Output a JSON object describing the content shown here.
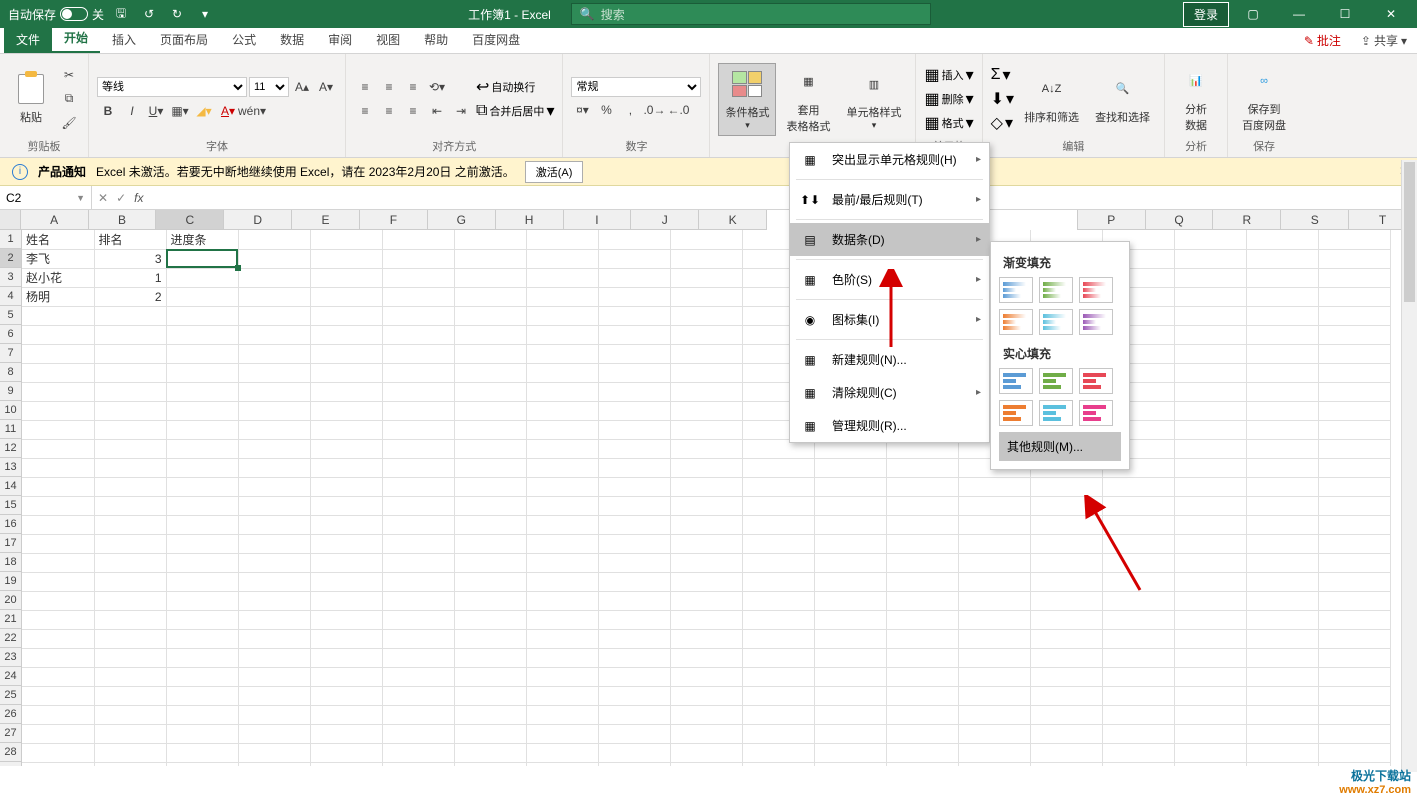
{
  "titlebar": {
    "autosave_label": "自动保存",
    "autosave_state": "关",
    "doc_title": "工作簿1 - Excel",
    "search_placeholder": "搜索",
    "login": "登录"
  },
  "tabs": {
    "file": "文件",
    "items": [
      "开始",
      "插入",
      "页面布局",
      "公式",
      "数据",
      "审阅",
      "视图",
      "帮助",
      "百度网盘"
    ],
    "active_index": 0,
    "comments": "批注",
    "share": "共享"
  },
  "ribbon": {
    "clipboard": {
      "paste": "粘贴",
      "label": "剪贴板"
    },
    "font": {
      "name": "等线",
      "size": "11",
      "label": "字体"
    },
    "align": {
      "wrap": "自动换行",
      "merge": "合并后居中",
      "label": "对齐方式"
    },
    "number": {
      "format": "常规",
      "label": "数字"
    },
    "styles": {
      "cond": "条件格式",
      "tablefmt_l1": "套用",
      "tablefmt_l2": "表格格式",
      "cellstyle": "单元格样式"
    },
    "cells": {
      "insert": "插入",
      "delete": "删除",
      "format": "格式",
      "label": "单元格"
    },
    "editing": {
      "sort": "排序和筛选",
      "find": "查找和选择",
      "label": "编辑"
    },
    "analysis": {
      "btn_l1": "分析",
      "btn_l2": "数据",
      "label": "分析"
    },
    "save": {
      "btn_l1": "保存到",
      "btn_l2": "百度网盘",
      "label": "保存"
    }
  },
  "notif": {
    "title": "产品通知",
    "msg": "Excel 未激活。若要无中断地继续使用 Excel，请在 2023年2月20日 之前激活。",
    "btn": "激活(A)"
  },
  "formula_bar": {
    "cell_ref": "C2",
    "fx": "fx",
    "value": ""
  },
  "sheet": {
    "columns": [
      "A",
      "B",
      "C",
      "D",
      "E",
      "F",
      "G",
      "H",
      "I",
      "J",
      "K",
      "P",
      "Q",
      "R",
      "S",
      "T"
    ],
    "sel_col": "C",
    "sel_row": 2,
    "headers": {
      "A": "姓名",
      "B": "排名",
      "C": "进度条"
    },
    "rows": [
      {
        "A": "李飞",
        "B": "3"
      },
      {
        "A": "赵小花",
        "B": "1"
      },
      {
        "A": "杨明",
        "B": "2"
      }
    ]
  },
  "menu": {
    "highlight": "突出显示单元格规则(H)",
    "toprules": "最前/最后规则(T)",
    "databar": "数据条(D)",
    "colorscale": "色阶(S)",
    "iconset": "图标集(I)",
    "newrule": "新建规则(N)...",
    "clear": "清除规则(C)",
    "manage": "管理规则(R)..."
  },
  "submenu": {
    "gradient": "渐变填充",
    "solid": "实心填充",
    "more": "其他规则(M)..."
  },
  "watermark": {
    "brand": "极光下载站",
    "url": "www.xz7.com"
  }
}
